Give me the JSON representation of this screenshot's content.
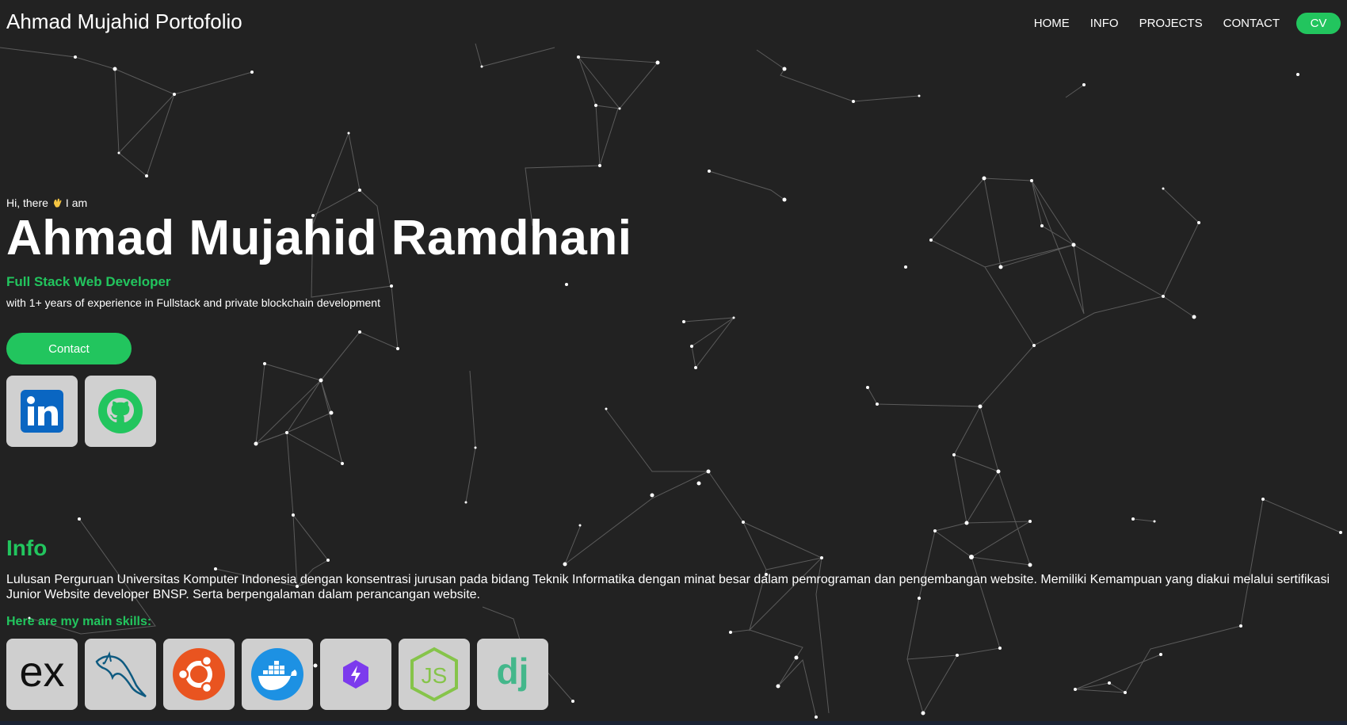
{
  "brand": "Ahmad Mujahid Portofolio",
  "nav": {
    "items": [
      "HOME",
      "INFO",
      "PROJECTS",
      "CONTACT"
    ],
    "cv_label": "CV"
  },
  "hero": {
    "greeting_before": "Hi, there",
    "greeting_after": "I am",
    "name": "Ahmad Mujahid Ramdhani",
    "role": "Full Stack Web Developer",
    "experience": "with 1+ years of experience in Fullstack and private blockchain development",
    "contact_label": "Contact"
  },
  "socials": [
    "linkedin-icon",
    "github-icon"
  ],
  "info": {
    "title": "Info",
    "description": "Lulusan Perguruan Universitas Komputer Indonesia dengan konsentrasi jurusan pada bidang Teknik Informatika dengan minat besar dalam pemrograman dan pengembangan website. Memiliki Kemampuan yang diakui melalui sertifikasi Junior Website developer BNSP. Serta berpengalaman dalam perancangan website.",
    "skills_title": "Here are my main skills:",
    "skills": [
      "express-icon",
      "mysql-icon",
      "ubuntu-icon",
      "docker-icon",
      "vite-icon",
      "nodejs-icon",
      "django-icon"
    ]
  },
  "colors": {
    "background": "#222222",
    "accent": "#22c55e",
    "tile": "#d0d0d0"
  }
}
